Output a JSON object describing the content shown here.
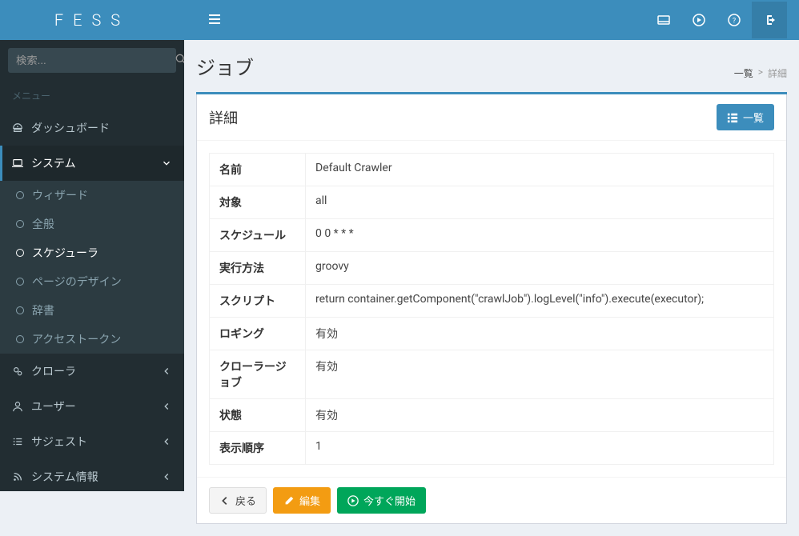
{
  "brand": "FESS",
  "search": {
    "placeholder": "検索..."
  },
  "menu_header": "メニュー",
  "sidebar": {
    "items": [
      {
        "label": "ダッシュボード"
      },
      {
        "label": "システム"
      },
      {
        "label": "クローラ"
      },
      {
        "label": "ユーザー"
      },
      {
        "label": "サジェスト"
      },
      {
        "label": "システム情報"
      }
    ],
    "subitems": [
      {
        "label": "ウィザード"
      },
      {
        "label": "全般"
      },
      {
        "label": "スケジューラ"
      },
      {
        "label": "ページのデザイン"
      },
      {
        "label": "辞書"
      },
      {
        "label": "アクセストークン"
      }
    ]
  },
  "page": {
    "title": "ジョブ",
    "breadcrumb": {
      "list": "一覧",
      "sep": ">",
      "detail": "詳細"
    },
    "panel_title": "詳細",
    "list_button": "一覧"
  },
  "detail": {
    "rows": [
      {
        "label": "名前",
        "value": "Default Crawler"
      },
      {
        "label": "対象",
        "value": "all"
      },
      {
        "label": "スケジュール",
        "value": "0 0 * * *"
      },
      {
        "label": "実行方法",
        "value": "groovy"
      },
      {
        "label": "スクリプト",
        "value": "return container.getComponent(\"crawlJob\").logLevel(\"info\").execute(executor);"
      },
      {
        "label": "ロギング",
        "value": "有効"
      },
      {
        "label": "クローラージョブ",
        "value": "有効"
      },
      {
        "label": "状態",
        "value": "有効"
      },
      {
        "label": "表示順序",
        "value": "1"
      }
    ]
  },
  "actions": {
    "back": "戻る",
    "edit": "編集",
    "start_now": "今すぐ開始"
  }
}
